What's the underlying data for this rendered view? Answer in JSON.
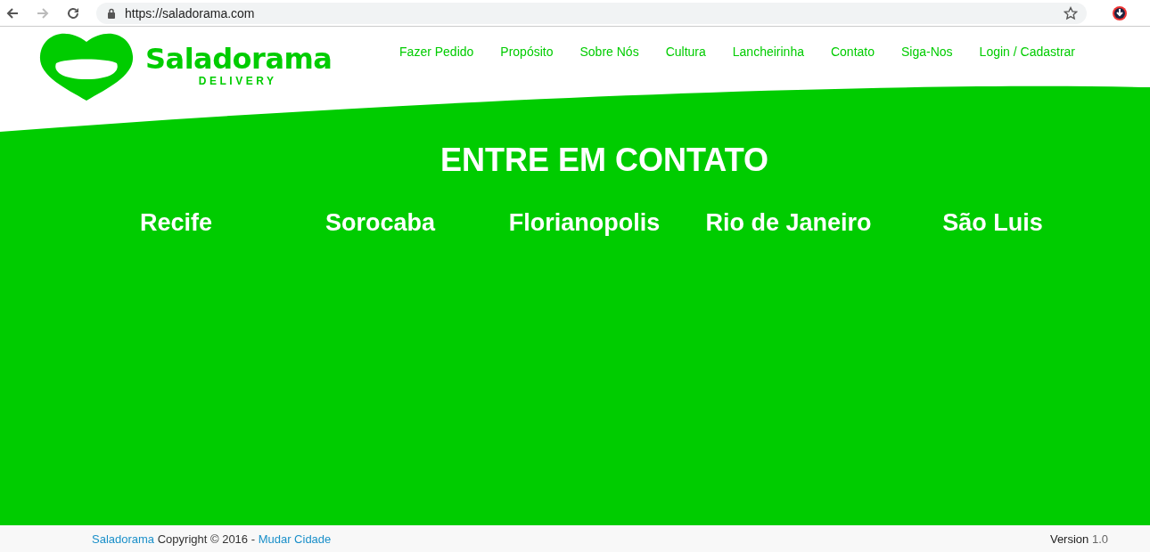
{
  "browser": {
    "url": "https://saladorama.com"
  },
  "logo": {
    "name": "Saladorama",
    "tagline": "DELIVERY"
  },
  "nav": [
    {
      "label": "Fazer Pedido"
    },
    {
      "label": "Propósito"
    },
    {
      "label": "Sobre Nós"
    },
    {
      "label": "Cultura"
    },
    {
      "label": "Lancheirinha"
    },
    {
      "label": "Contato"
    },
    {
      "label": "Siga-Nos"
    },
    {
      "label": "Login / Cadastrar"
    }
  ],
  "heading": "ENTRE EM CONTATO",
  "cities": [
    "Recife",
    "Sorocaba",
    "Florianopolis",
    "Rio de Janeiro",
    "São Luis"
  ],
  "footer": {
    "brand_link": "Saladorama",
    "copyright": "Copyright © 2016 -",
    "city_link": "Mudar Cidade",
    "version_label": "Version",
    "version_number": "1.0"
  }
}
